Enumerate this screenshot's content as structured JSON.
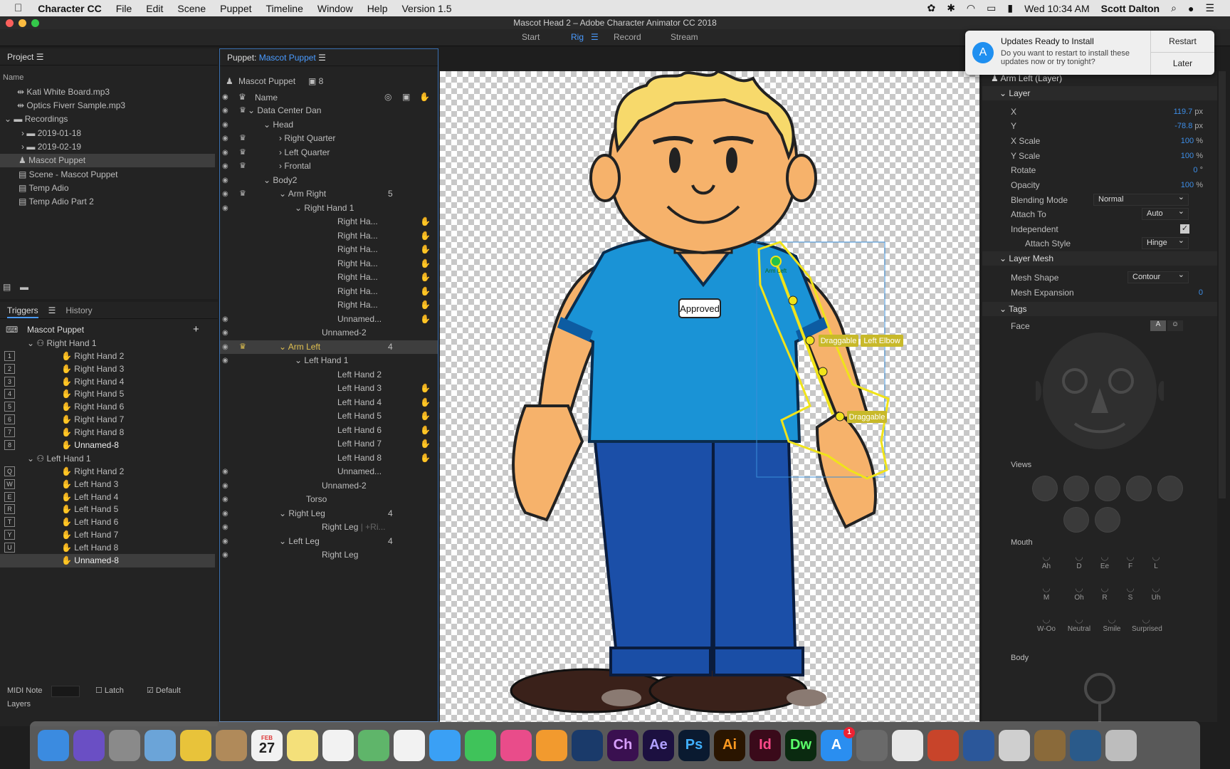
{
  "menubar": {
    "app": "Character CC",
    "items": [
      "File",
      "Edit",
      "Scene",
      "Puppet",
      "Timeline",
      "Window",
      "Help",
      "Version 1.5"
    ],
    "clock": "Wed 10:34 AM",
    "user": "Scott Dalton"
  },
  "window": {
    "title": "Mascot Head 2 – Adobe Character Animator CC 2018"
  },
  "workspace": {
    "tabs": [
      "Start",
      "Rig",
      "Record",
      "Stream"
    ],
    "active": "Rig"
  },
  "notification": {
    "title": "Updates Ready to Install",
    "body": "Do you want to restart to install these updates now or try tonight?",
    "restart": "Restart",
    "later": "Later"
  },
  "project": {
    "title": "Project",
    "column": "Name",
    "items": [
      "Kati White Board.mp3",
      "Optics Fiverr Sample.mp3",
      "Recordings",
      "2019-01-18",
      "2019-02-19",
      "Mascot Puppet",
      "Scene - Mascot Puppet",
      "Temp Adio",
      "Temp Adio Part 2"
    ]
  },
  "triggers": {
    "tab": "Triggers",
    "history": "History",
    "puppet": "Mascot Puppet",
    "right_group": "Right Hand 1",
    "right_items": [
      "Right Hand 2",
      "Right Hand 3",
      "Right Hand 4",
      "Right Hand 5",
      "Right Hand 6",
      "Right Hand 7",
      "Right Hand 8",
      "Unnamed-8"
    ],
    "right_keys": [
      "1",
      "2",
      "3",
      "4",
      "5",
      "6",
      "7",
      "8"
    ],
    "left_group": "Left Hand 1",
    "left_items": [
      "Right Hand 2",
      "Left Hand 3",
      "Left Hand 4",
      "Left Hand 5",
      "Left Hand 6",
      "Left Hand 7",
      "Left Hand 8",
      "Unnamed-8"
    ],
    "left_keys": [
      "Q",
      "W",
      "E",
      "R",
      "T",
      "Y",
      "U",
      "I"
    ],
    "midi": "MIDI Note",
    "latch": "Latch",
    "default": "Default",
    "layers": "Layers"
  },
  "puppet": {
    "label": "Puppet:",
    "name": "Mascot Puppet",
    "root": "Mascot Puppet",
    "count": "8",
    "col_name": "Name",
    "rows": [
      {
        "t": "Data Center Dan",
        "i": 0,
        "tw": "v"
      },
      {
        "t": "Head",
        "i": 1,
        "tw": "v"
      },
      {
        "t": "Right Quarter",
        "i": 2,
        "tw": ">"
      },
      {
        "t": "Left Quarter",
        "i": 2,
        "tw": ">"
      },
      {
        "t": "Frontal",
        "i": 2,
        "tw": ">"
      },
      {
        "t": "Body2",
        "i": 1,
        "tw": "v"
      },
      {
        "t": "Arm Right",
        "i": 2,
        "tw": "v",
        "n": "5"
      },
      {
        "t": "Right Hand 1",
        "i": 3,
        "tw": "v"
      },
      {
        "t": "Right Ha...",
        "i": 5
      },
      {
        "t": "Right Ha...",
        "i": 5
      },
      {
        "t": "Right Ha...",
        "i": 5
      },
      {
        "t": "Right Ha...",
        "i": 5
      },
      {
        "t": "Right Ha...",
        "i": 5
      },
      {
        "t": "Right Ha...",
        "i": 5
      },
      {
        "t": "Right Ha...",
        "i": 5
      },
      {
        "t": "Unnamed...",
        "i": 5
      },
      {
        "t": "Unnamed-2",
        "i": 4
      },
      {
        "t": "Arm Left",
        "i": 2,
        "tw": "v",
        "n": "4",
        "sel": true
      },
      {
        "t": "Left Hand 1",
        "i": 3,
        "tw": "v"
      },
      {
        "t": "Left Hand 2",
        "i": 5
      },
      {
        "t": "Left Hand 3",
        "i": 5
      },
      {
        "t": "Left Hand 4",
        "i": 5
      },
      {
        "t": "Left Hand 5",
        "i": 5
      },
      {
        "t": "Left Hand 6",
        "i": 5
      },
      {
        "t": "Left Hand 7",
        "i": 5
      },
      {
        "t": "Left Hand 8",
        "i": 5
      },
      {
        "t": "Unnamed...",
        "i": 5
      },
      {
        "t": "Unnamed-2",
        "i": 4
      },
      {
        "t": "Torso",
        "i": 3
      },
      {
        "t": "Right Leg",
        "i": 2,
        "tw": "v",
        "n": "4"
      },
      {
        "t": "Right Leg",
        "i": 4,
        "extra": "| +Ri..."
      },
      {
        "t": "Left Leg",
        "i": 2,
        "tw": "v",
        "n": "4"
      },
      {
        "t": "Right Leg",
        "i": 4
      }
    ]
  },
  "canvas": {
    "badge": "Approved",
    "tags": [
      "Draggable",
      "Left Elbow",
      "Draggable"
    ],
    "handle": "Arm Left"
  },
  "properties": {
    "layer_name": "Arm Left (Layer)",
    "layer_section": "Layer",
    "x": "119.7",
    "x_unit": "px",
    "y": "-78.8",
    "y_unit": "px",
    "xscale": "100",
    "yscale": "100",
    "pct": "%",
    "rotate": "0",
    "deg": "°",
    "opacity": "100",
    "labels": [
      "X",
      "Y",
      "X Scale",
      "Y Scale",
      "Rotate",
      "Opacity",
      "Blending Mode",
      "Attach To",
      "Independent",
      "Attach Style"
    ],
    "blending": "Normal",
    "attach_to": "Auto",
    "attach_style": "Hinge",
    "mesh_section": "Layer Mesh",
    "mesh_shape_label": "Mesh Shape",
    "mesh_shape": "Contour",
    "mesh_exp_label": "Mesh Expansion",
    "mesh_exp": "0",
    "tags_section": "Tags",
    "face": "Face",
    "views": "Views",
    "mouth": "Mouth",
    "body": "Body",
    "mouth_labels": [
      "Ah",
      "D",
      "Ee",
      "F",
      "L",
      "M",
      "Oh",
      "R",
      "S",
      "Uh",
      "W-Oo",
      "Neutral",
      "Smile",
      "Surprised"
    ]
  },
  "dock": {
    "apps": [
      "Finder",
      "Siri",
      "Launchpad",
      "Preview",
      "Chrome",
      "Contacts",
      "Calendar",
      "Notes",
      "Reminders",
      "Maps",
      "Photos",
      "Messages",
      "FaceTime",
      "iTunes",
      "Books",
      "Cinema 4D",
      "Ch",
      "Ae",
      "Ps",
      "Ai",
      "Id",
      "Dw",
      "App Store",
      "System Preferences",
      "Acrobat",
      "PowerPoint",
      "Word",
      "Archive",
      "Installer",
      "QuickTime",
      "Trash"
    ],
    "calendar_day": "27",
    "calendar_month": "FEB",
    "appstore_badge": "1"
  }
}
